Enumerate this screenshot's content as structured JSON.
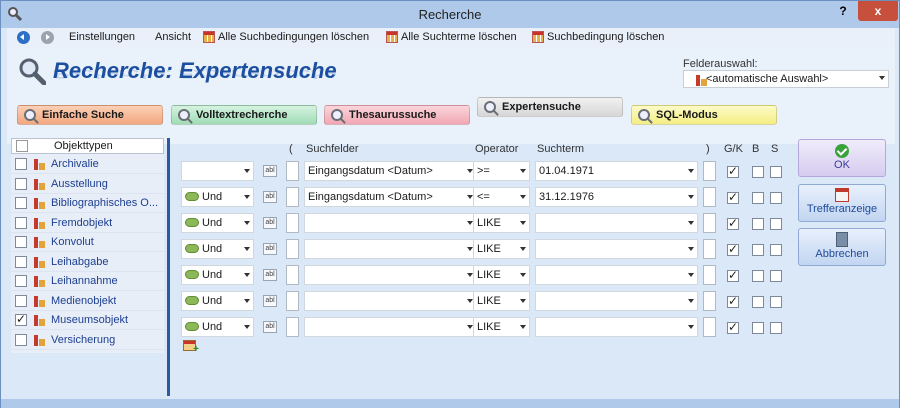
{
  "window": {
    "title": "Recherche",
    "help_label": "?",
    "close_label": "x"
  },
  "menubar": [
    {
      "label": "Einstellungen"
    },
    {
      "label": "Ansicht"
    },
    {
      "label": "Alle Suchbedingungen löschen"
    },
    {
      "label": "Alle Suchterme löschen"
    },
    {
      "label": "Suchbedingung löschen"
    }
  ],
  "header": {
    "title": "Recherche: Expertensuche",
    "felder_label": "Felderauswahl:",
    "felder_value": "<automatische Auswahl>"
  },
  "tabs": [
    {
      "label": "Einfache Suche"
    },
    {
      "label": "Volltextrecherche"
    },
    {
      "label": "Thesaurussuche"
    },
    {
      "label": "Expertensuche"
    },
    {
      "label": "SQL-Modus"
    }
  ],
  "objekttypen": {
    "header": "Objekttypen",
    "items": [
      {
        "label": "Archivalie",
        "checked": false
      },
      {
        "label": "Ausstellung",
        "checked": false
      },
      {
        "label": "Bibliographisches O...",
        "checked": false
      },
      {
        "label": "Fremdobjekt",
        "checked": false
      },
      {
        "label": "Konvolut",
        "checked": false
      },
      {
        "label": "Leihabgabe",
        "checked": false
      },
      {
        "label": "Leihannahme",
        "checked": false
      },
      {
        "label": "Medienobjekt",
        "checked": false
      },
      {
        "label": "Museumsobjekt",
        "checked": true
      },
      {
        "label": "Versicherung",
        "checked": false
      }
    ]
  },
  "columns": {
    "open_paren": "(",
    "suchfelder": "Suchfelder",
    "operator": "Operator",
    "suchterm": "Suchterm",
    "close_paren": ")",
    "gk": "G/K",
    "b": "B",
    "s": "S"
  },
  "conditions": [
    {
      "logic": "",
      "field": "Eingangsdatum <Datum>",
      "operator": ">=",
      "term": "01.04.1971",
      "gk": true,
      "b": false,
      "s": false
    },
    {
      "logic": "Und",
      "field": "Eingangsdatum <Datum>",
      "operator": "<=",
      "term": "31.12.1976",
      "gk": true,
      "b": false,
      "s": false
    },
    {
      "logic": "Und",
      "field": "",
      "operator": "LIKE",
      "term": "",
      "gk": true,
      "b": false,
      "s": false
    },
    {
      "logic": "Und",
      "field": "",
      "operator": "LIKE",
      "term": "",
      "gk": true,
      "b": false,
      "s": false
    },
    {
      "logic": "Und",
      "field": "",
      "operator": "LIKE",
      "term": "",
      "gk": true,
      "b": false,
      "s": false
    },
    {
      "logic": "Und",
      "field": "",
      "operator": "LIKE",
      "term": "",
      "gk": true,
      "b": false,
      "s": false
    },
    {
      "logic": "Und",
      "field": "",
      "operator": "LIKE",
      "term": "",
      "gk": true,
      "b": false,
      "s": false
    }
  ],
  "ab_icon_text": "abl",
  "actions": {
    "ok": "OK",
    "treffer": "Trefferanzeige",
    "abbrechen": "Abbrechen"
  }
}
